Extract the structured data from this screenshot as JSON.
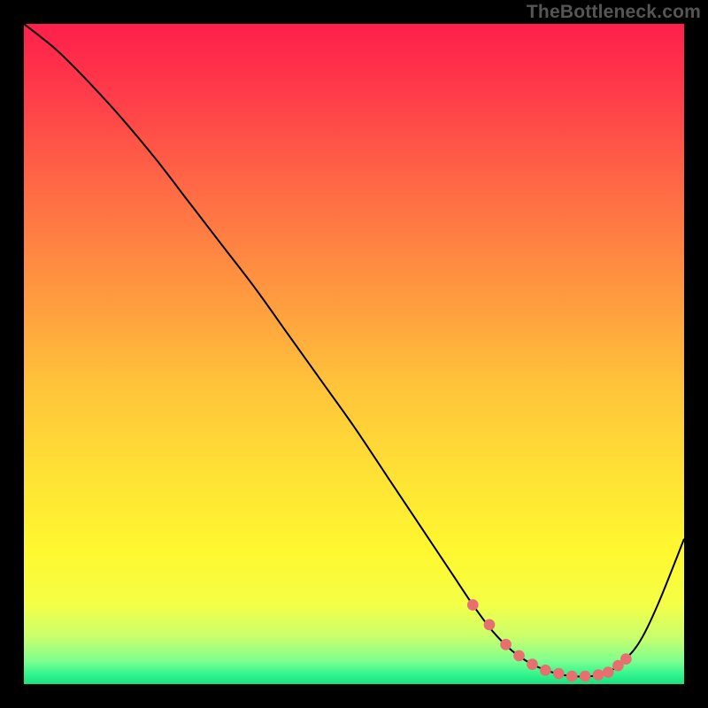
{
  "watermark": "TheBottleneck.com",
  "colors": {
    "frame_bg": "#000000",
    "watermark": "#555555",
    "curve": "#000000",
    "dot_fill": "#e76f6f",
    "dot_stroke": "#e76f6f",
    "gradient_stops": [
      {
        "offset": 0.0,
        "color": "#ff1f4b"
      },
      {
        "offset": 0.1,
        "color": "#ff3a4a"
      },
      {
        "offset": 0.25,
        "color": "#ff6a45"
      },
      {
        "offset": 0.4,
        "color": "#ff9640"
      },
      {
        "offset": 0.55,
        "color": "#ffc43a"
      },
      {
        "offset": 0.7,
        "color": "#ffe534"
      },
      {
        "offset": 0.8,
        "color": "#fff82f"
      },
      {
        "offset": 0.88,
        "color": "#f4ff47"
      },
      {
        "offset": 0.93,
        "color": "#c7ff6e"
      },
      {
        "offset": 0.965,
        "color": "#7dff8f"
      },
      {
        "offset": 0.985,
        "color": "#33f58e"
      },
      {
        "offset": 1.0,
        "color": "#17e27e"
      }
    ]
  },
  "chart_data": {
    "type": "line",
    "title": "",
    "xlabel": "",
    "ylabel": "",
    "xlim": [
      0,
      100
    ],
    "ylim": [
      0,
      100
    ],
    "grid": false,
    "series": [
      {
        "name": "bottleneck-curve",
        "x": [
          0,
          5,
          10,
          15,
          20,
          25,
          30,
          35,
          40,
          45,
          50,
          55,
          60,
          65,
          68,
          71,
          74,
          77,
          80,
          83,
          86,
          88,
          90,
          93,
          96,
          100
        ],
        "y": [
          100,
          96,
          91,
          85.5,
          79.5,
          73,
          66.5,
          60,
          53,
          46,
          39,
          31.5,
          24,
          16.5,
          12,
          8,
          5,
          3,
          1.8,
          1.2,
          1.2,
          1.6,
          2.8,
          6,
          12,
          22
        ]
      }
    ],
    "highlighted_points": {
      "name": "valley-dots",
      "x": [
        68.0,
        70.5,
        73.0,
        75.0,
        77.0,
        79.0,
        81.0,
        83.0,
        85.0,
        87.0,
        88.5,
        90.0,
        91.2
      ],
      "y": [
        12.0,
        9.0,
        6.0,
        4.3,
        3.0,
        2.1,
        1.6,
        1.2,
        1.2,
        1.4,
        1.8,
        2.8,
        3.8
      ]
    }
  }
}
